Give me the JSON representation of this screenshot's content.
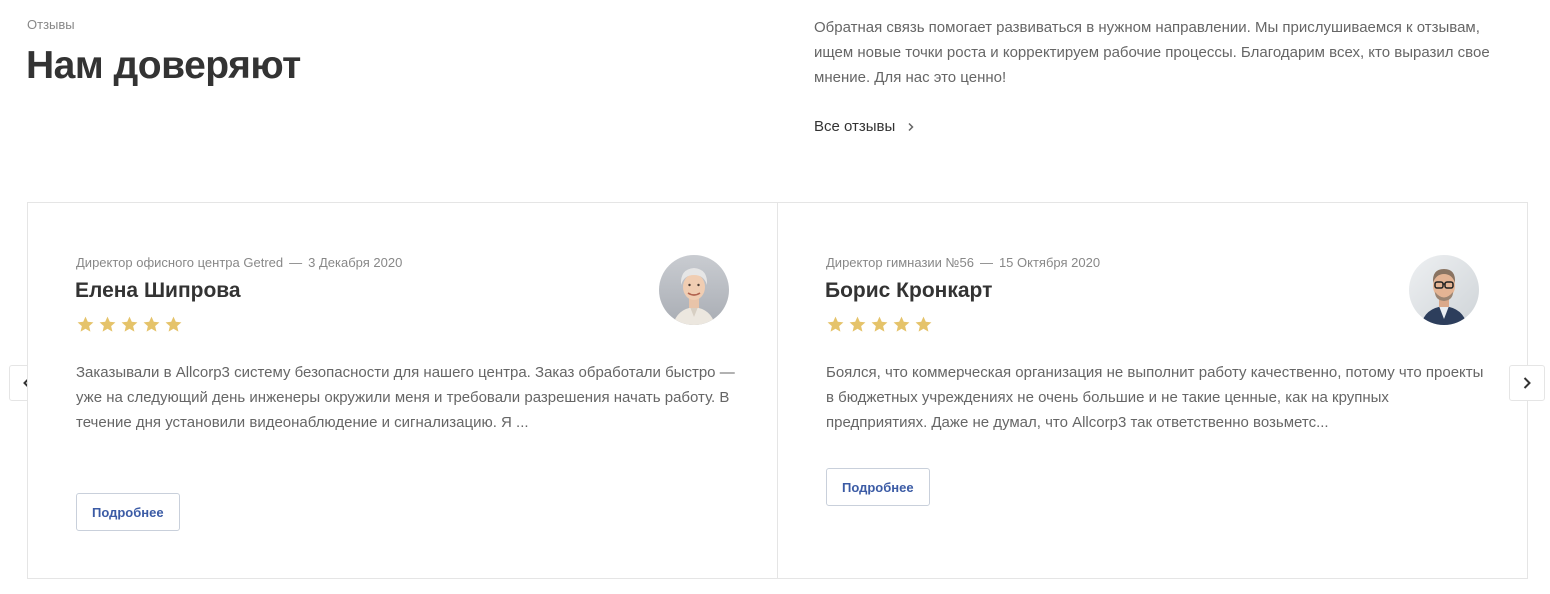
{
  "section": {
    "eyebrow": "Отзывы",
    "title": "Нам доверяют",
    "intro": "Обратная связь помогает развиваться в нужном направлении. Мы прислушиваемся к отзывам, ищем новые точки роста и корректируем рабочие процессы. Благодарим всех, кто выразил свое мнение. Для нас это ценно!",
    "all_reviews_label": "Все отзывы"
  },
  "reviews": [
    {
      "position": "Директор офисного центра Getred",
      "separator": "—",
      "date": "3 Декабря 2020",
      "name": "Елена Шипрова",
      "rating": 5,
      "text": "Заказывали в Allcorp3 систему безопасности для нашего центра. Заказ обработали быстро — уже на следующий день инженеры окружили меня и требовали разрешения начать работу. В течение дня установили видеонаблюдение и сигнализацию. Я ...",
      "button_label": "Подробнее"
    },
    {
      "position": "Директор гимназии №56",
      "separator": "—",
      "date": "15 Октября 2020",
      "name": "Борис Кронкарт",
      "rating": 5,
      "text": "Боялся, что коммерческая организация не выполнит работу качественно, потому что проекты в бюджетных учреждениях не очень большие и не такие ценные, как на крупных предприятиях. Даже не думал, что Allcorp3 так ответственно возьметс...",
      "button_label": "Подробнее"
    }
  ],
  "icons": {
    "star": "star-icon",
    "prev": "chevron-left-icon",
    "next": "chevron-right-icon",
    "link_arrow": "chevron-right-icon"
  },
  "colors": {
    "star": "#e5c36a",
    "button_text": "#3b5ba5",
    "title": "#333333",
    "muted": "#888888"
  }
}
